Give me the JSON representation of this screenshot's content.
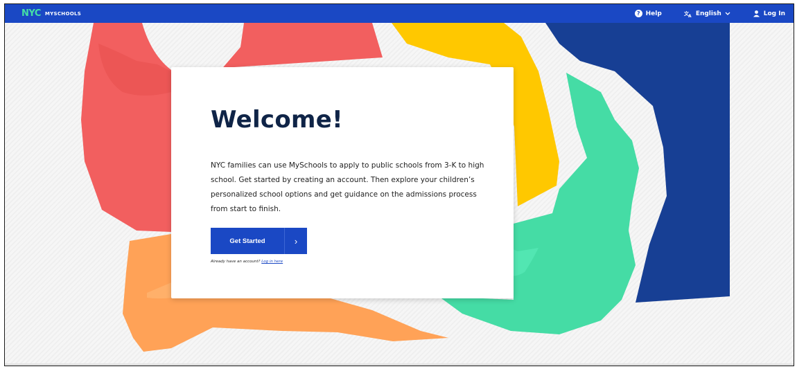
{
  "header": {
    "logo_mark": "NYC",
    "logo_text": "MYSCHOOLS",
    "help_label": "Help",
    "language_label": "English",
    "login_label": "Log In"
  },
  "welcome": {
    "title": "Welcome!",
    "description": "NYC families can use MySchools to apply to public schools from 3-K to high school. Get started by creating an account. Then explore your children’s personalized school options and get guidance on the admissions process from start to finish.",
    "cta_label": "Get Started",
    "already_text": "Already have an account?",
    "login_link": "Log in here"
  },
  "colors": {
    "header_bg": "#1a48c4",
    "accent_green": "#45e0a5",
    "red_shape": "#f25f5f",
    "yellow_shape": "#ffc800",
    "orange_shape": "#ffa257",
    "teal_shape": "#45dca5",
    "navy_shape": "#173f94",
    "title_color": "#0f2447"
  }
}
